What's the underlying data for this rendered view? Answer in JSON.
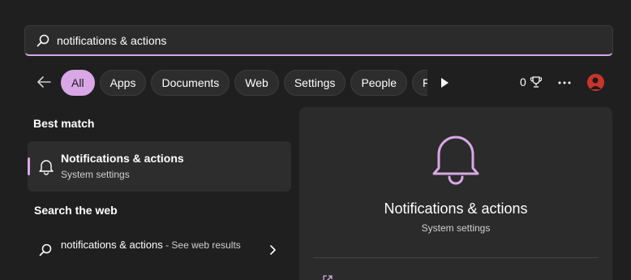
{
  "search": {
    "query": "notifications & actions"
  },
  "filters": [
    "All",
    "Apps",
    "Documents",
    "Web",
    "Settings",
    "People",
    "Folde"
  ],
  "toolbar": {
    "points": "0"
  },
  "best_match": {
    "heading": "Best match",
    "title": "Notifications & actions",
    "subtitle": "System settings"
  },
  "web": {
    "heading": "Search the web",
    "query": "notifications & actions",
    "suffix": " - See web results"
  },
  "preview": {
    "title": "Notifications & actions",
    "subtitle": "System settings"
  },
  "colors": {
    "accent": "#d9a7e6",
    "background": "#1f1f1f",
    "panel": "#2b2b2b"
  },
  "icons": [
    "search-icon",
    "back-arrow-icon",
    "play-icon",
    "trophy-icon",
    "more-icon",
    "bell-icon",
    "chevron-right-icon",
    "open-icon"
  ]
}
